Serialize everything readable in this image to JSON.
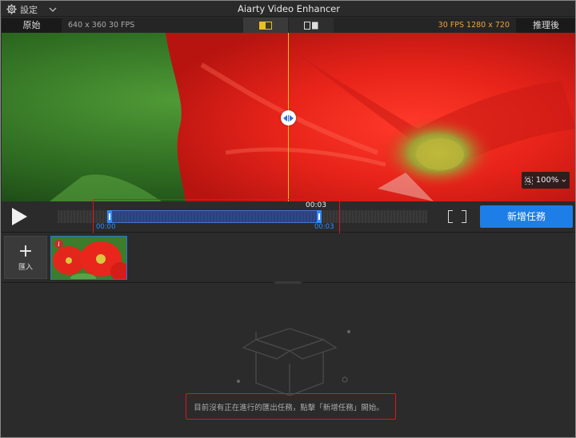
{
  "titlebar": {
    "settings_label": "設定",
    "app_title": "Aiarty Video Enhancer"
  },
  "compare": {
    "original_tab": "原始",
    "original_meta": "640 x 360  30 FPS",
    "enhanced_meta": "30 FPS  1280 x 720",
    "enhanced_tab": "推理後"
  },
  "preview": {
    "zoom": "100%"
  },
  "timeline": {
    "current_time": "00:03",
    "in_time": "00:00",
    "out_time": "00:03",
    "add_task_label": "新增任務"
  },
  "media": {
    "import_label": "匯入"
  },
  "tasks": {
    "empty_message": "目前沒有正在進行的匯出任務，點擊「新增任務」開始。"
  },
  "colors": {
    "accent": "#1e7ee8",
    "highlight": "#e0141e",
    "divider": "#e8c020"
  }
}
